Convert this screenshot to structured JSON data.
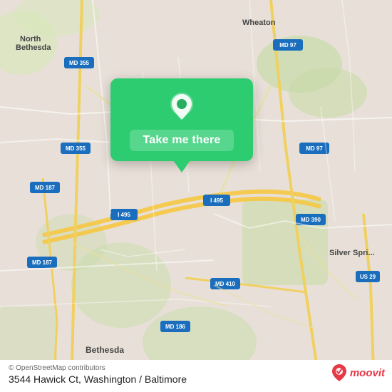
{
  "map": {
    "background_color": "#e8e0d8",
    "center_lat": 38.98,
    "center_lon": -77.07
  },
  "popup": {
    "button_label": "Take me there",
    "background_color": "#27ae60"
  },
  "address": {
    "text": "3544 Hawick Ct, Washington / Baltimore"
  },
  "credit": {
    "text": "© OpenStreetMap contributors"
  },
  "moovit": {
    "text": "moovit"
  },
  "labels": {
    "north_bethesda": "North\nBethesda",
    "wheaton": "Wheaton",
    "bethesda": "Bethesda",
    "silver_spring": "Silver Spri...",
    "md355_1": "MD 355",
    "md355_2": "MD 355",
    "md97_1": "MD 97",
    "md97_2": "MD 97",
    "md187_1": "MD 187",
    "md187_2": "MD 187",
    "i495_1": "I 495",
    "i495_2": "I 495",
    "md390": "MD 390",
    "md410": "MD 410",
    "md186": "MD 186",
    "us29": "US 29"
  }
}
